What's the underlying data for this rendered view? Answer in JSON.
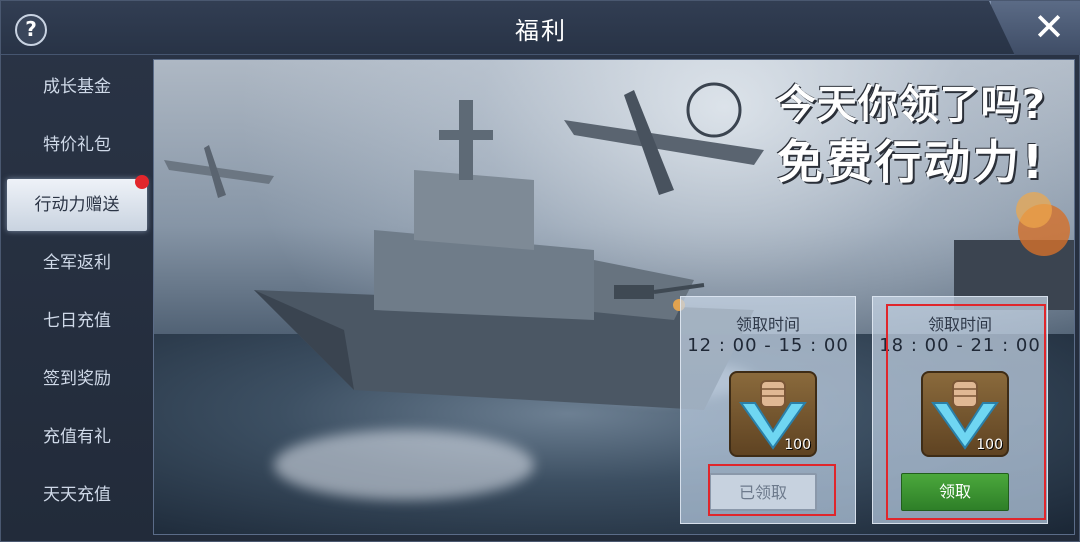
{
  "window": {
    "title": "福利"
  },
  "controls": {
    "help_icon": "?",
    "close_icon": "✕"
  },
  "sidebar": {
    "items": [
      {
        "label": "成长基金",
        "active": false
      },
      {
        "label": "特价礼包",
        "active": false
      },
      {
        "label": "行动力赠送",
        "active": true,
        "badge": true
      },
      {
        "label": "全军返利",
        "active": false
      },
      {
        "label": "七日充值",
        "active": false
      },
      {
        "label": "签到奖励",
        "active": false
      },
      {
        "label": "充值有礼",
        "active": false
      },
      {
        "label": "天天充值",
        "active": false
      }
    ]
  },
  "banner": {
    "headline_line1": "今天你领了吗?",
    "headline_line2": "免费行动力!"
  },
  "cards": [
    {
      "label": "领取时间",
      "time": "12 : 00 - 15 : 00",
      "item_count": "100",
      "button": "已领取",
      "status": "claimed"
    },
    {
      "label": "领取时间",
      "time": "18 : 00 - 21 : 00",
      "item_count": "100",
      "button": "领取",
      "status": "available"
    }
  ],
  "colors": {
    "accent_red": "#e0262b",
    "claim_green": "#3a9a33",
    "badge_red": "#e2262c"
  }
}
